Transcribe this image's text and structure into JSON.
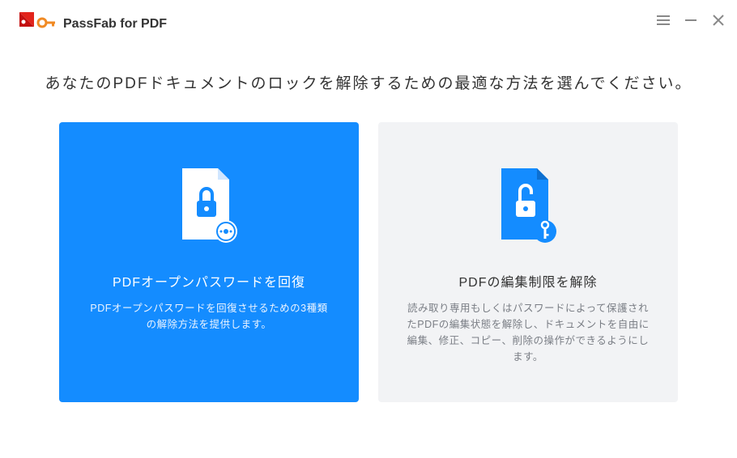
{
  "app": {
    "title": "PassFab for PDF"
  },
  "heading": "あなたのPDFドキュメントのロックを解除するための最適な方法を選んでください。",
  "cards": {
    "recover": {
      "title": "PDFオープンパスワードを回復",
      "desc": "PDFオープンパスワードを回復させるための3種類の解除方法を提供します。"
    },
    "remove": {
      "title": "PDFの編集制限を解除",
      "desc": "読み取り専用もしくはパスワードによって保護されたPDFの編集状態を解除し、ドキュメントを自由に編集、修正、コピー、削除の操作ができるようにします。"
    }
  }
}
